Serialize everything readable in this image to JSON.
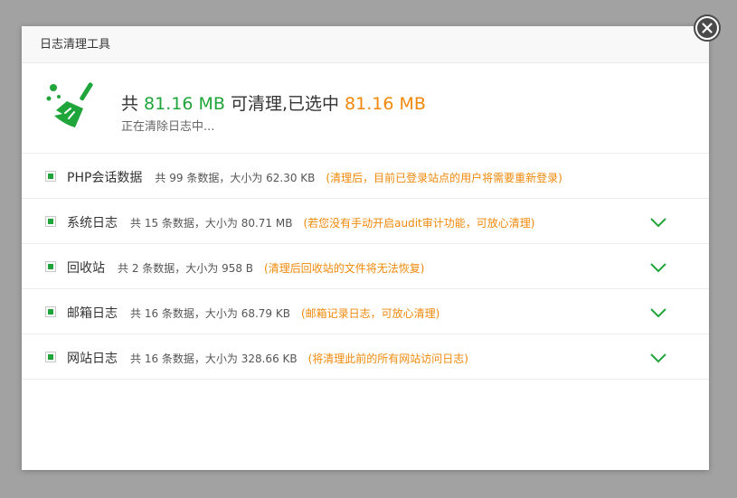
{
  "dialog": {
    "title": "日志清理工具"
  },
  "summary": {
    "prefix": "共 ",
    "total_size": "81.16 MB",
    "middle": " 可清理,已选中 ",
    "selected_size": "81.16 MB",
    "status": "正在清除日志中..."
  },
  "items": [
    {
      "name": "PHP会话数据",
      "count": "共 99 条数据，大小为 62.30 KB",
      "note": "(清理后，目前已登录站点的用户将需要重新登录)"
    },
    {
      "name": "系统日志",
      "count": "共 15 条数据，大小为 80.71 MB",
      "note": "(若您没有手动开启audit审计功能，可放心清理)"
    },
    {
      "name": "回收站",
      "count": "共 2 条数据，大小为 958 B",
      "note": "(清理后回收站的文件将无法恢复)"
    },
    {
      "name": "邮箱日志",
      "count": "共 16 条数据，大小为 68.79 KB",
      "note": "(邮箱记录日志，可放心清理)"
    },
    {
      "name": "网站日志",
      "count": "共 16 条数据，大小为 328.66 KB",
      "note": "(将清理此前的所有网站访问日志)"
    }
  ],
  "colors": {
    "accent_green": "#20a53a",
    "accent_orange": "#f0880a"
  },
  "icons": {
    "summary": "broom-icon",
    "expand": "chevron-down-icon",
    "close": "close-icon"
  }
}
